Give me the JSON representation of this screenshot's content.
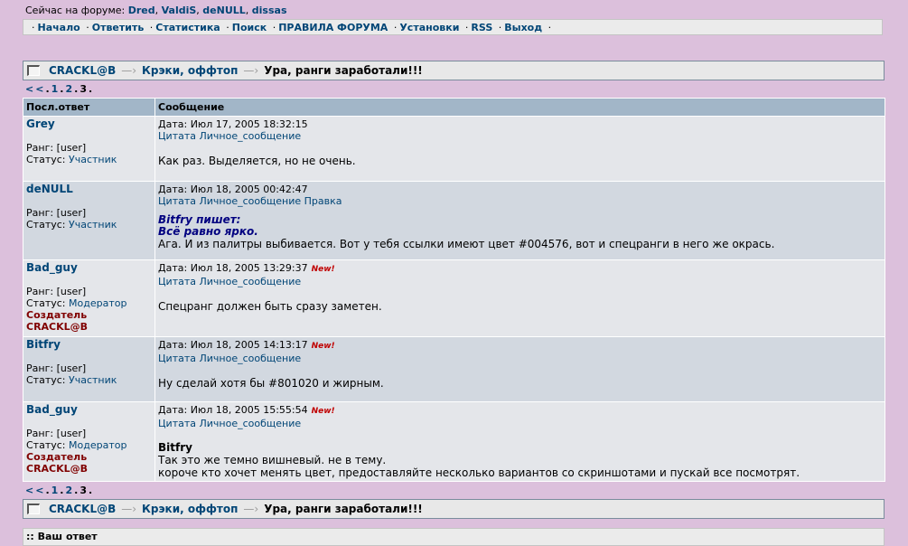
{
  "online": {
    "label": "Сейчас на форуме:",
    "users": [
      "Dred",
      "ValdiS",
      "deNULL",
      "dissas"
    ]
  },
  "nav": [
    "Начало",
    "Ответить",
    "Статистика",
    "Поиск",
    "ПРАВИЛА ФОРУМА",
    "Установки",
    "RSS",
    "Выход"
  ],
  "breadcrumb": {
    "forum": "CRACKL@B",
    "section": "Крэки, оффтоп",
    "topic": "Ура, ранги заработали!!!",
    "arrow": "—›"
  },
  "pager": {
    "prev": "<<",
    "pages": [
      "1",
      "2"
    ],
    "current": "3"
  },
  "table": {
    "col_author": "Посл.ответ",
    "col_message": "Сообщение"
  },
  "labels": {
    "rank": "Ранг:",
    "status": "Статус:",
    "date": "Дата:",
    "quote": "Цитата",
    "pm": "Личное_сообщение",
    "edit": "Правка",
    "new": "New!"
  },
  "posts": [
    {
      "author": "Grey",
      "rank": "[user]",
      "status": "Участник",
      "date": "Июл 17, 2005 18:32:15",
      "lines": [
        "Как раз. Выделяется, но не очень."
      ]
    },
    {
      "author": "deNULL",
      "rank": "[user]",
      "status": "Участник",
      "date": "Июл 18, 2005 00:42:47",
      "quote_header": "Bitfry пишет:",
      "quote_text": "Всё равно ярко.",
      "lines": [
        "Ага. И из палитры выбивается. Вот у тебя ссылки имеют цвет #004576, вот и спецранги в него же окрась."
      ]
    },
    {
      "author": "Bad_guy",
      "rank": "[user]",
      "status": "Модератор",
      "special": "Создатель CRACKL@B",
      "date": "Июл 18, 2005 13:29:37",
      "lines": [
        "Спецранг должен быть сразу заметен."
      ]
    },
    {
      "author": "Bitfry",
      "rank": "[user]",
      "status": "Участник",
      "date": "Июл 18, 2005 14:13:17",
      "lines": [
        "Ну сделай хотя бы #801020 и жирным."
      ]
    },
    {
      "author": "Bad_guy",
      "rank": "[user]",
      "status": "Модератор",
      "special": "Создатель CRACKL@B",
      "date": "Июл 18, 2005 15:55:54",
      "addressee": "Bitfry",
      "lines": [
        "Так это же темно вишневый. не в тему.",
        "короче кто хочет менять цвет, предоставляйте несколько вариантов со скриншотами и пускай все посмотрят."
      ]
    }
  ],
  "reply": {
    "title": ":: Ваш ответ"
  },
  "colors": {
    "background": "#dcc0dc",
    "link": "#004576",
    "special_rank": "#800000",
    "header": "#a2b6c8",
    "row_light": "#e4e6ea",
    "row_dark": "#d2d8e0"
  }
}
